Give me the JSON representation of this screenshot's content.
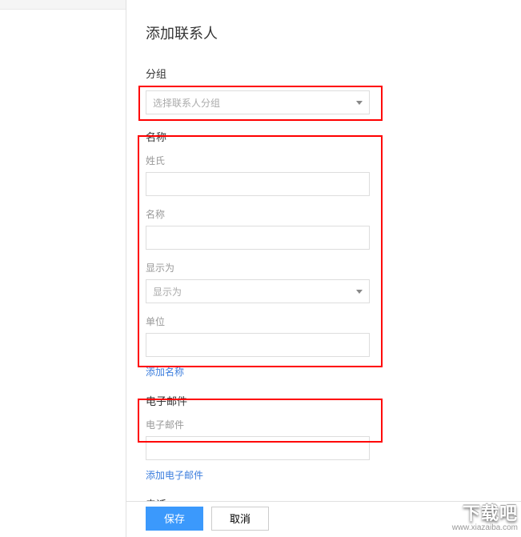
{
  "page": {
    "title": "添加联系人"
  },
  "sections": {
    "group": {
      "label": "分组",
      "select_placeholder": "选择联系人分组"
    },
    "name": {
      "label": "名称",
      "fields": {
        "surname_label": "姓氏",
        "surname_value": "",
        "givenname_label": "名称",
        "givenname_value": "",
        "displayas_label": "显示为",
        "displayas_placeholder": "显示为",
        "company_label": "单位",
        "company_value": ""
      },
      "add_link": "添加名称"
    },
    "email": {
      "label": "电子邮件",
      "fields": {
        "email_label": "电子邮件",
        "email_value": ""
      },
      "add_link": "添加电子邮件"
    },
    "phone": {
      "label": "电话"
    }
  },
  "footer": {
    "save_label": "保存",
    "cancel_label": "取消"
  },
  "watermark": {
    "top": "下载吧",
    "bottom": "www.xiazaiba.com"
  }
}
